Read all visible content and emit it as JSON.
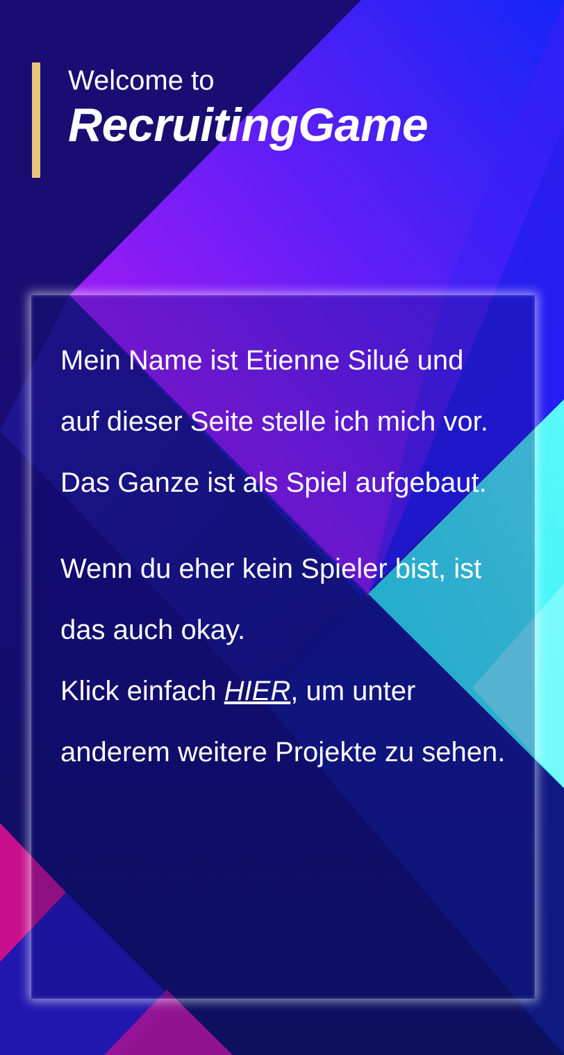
{
  "header": {
    "welcome": "Welcome to",
    "brand": "RecruitingGame"
  },
  "intro": {
    "line1": "Mein Name ist Etienne Silué und auf dieser Seite stelle ich mich vor.",
    "line2": "Das Ganze ist als Spiel aufgebaut."
  },
  "alt": {
    "line1": "Wenn du eher kein Spieler bist, ist das auch okay.",
    "link_prefix": "Klick einfach ",
    "link_label": "HIER",
    "link_suffix": ", um unter anderem weitere Projekte zu sehen."
  },
  "colors": {
    "accent_bar": "#e9c47c",
    "background_dark": "#170a6e",
    "magenta": "#c41ff0",
    "blue": "#0a28f5",
    "cyan": "#22f5f5",
    "pink": "#c8108c"
  }
}
